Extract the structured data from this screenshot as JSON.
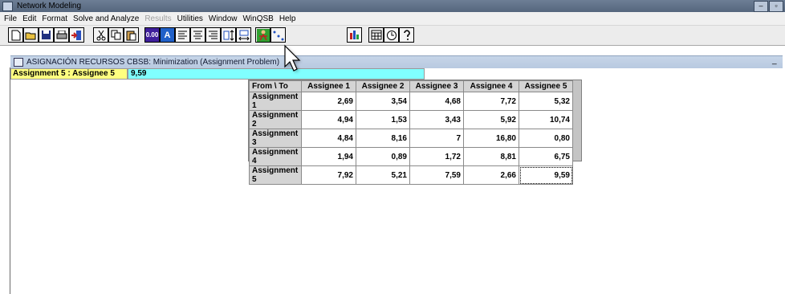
{
  "window": {
    "title": "Network Modeling",
    "controls": [
      "–",
      "▫"
    ]
  },
  "menu": [
    "File",
    "Edit",
    "Format",
    "Solve and Analyze",
    "Results",
    "Utilities",
    "Window",
    "WinQSB",
    "Help"
  ],
  "menu_disabled": [
    "Results"
  ],
  "toolbar": {
    "number_format_label": "0.00",
    "font_label": "A"
  },
  "child_window": {
    "title": "ASIGNACIÓN RECURSOS CBSB: Minimization (Assignment Problem)",
    "minimize": "_"
  },
  "edit_bar": {
    "cell_ref": "Assignment 5 : Assignee 5",
    "cell_value": "9,59"
  },
  "table": {
    "corner": "From \\ To",
    "columns": [
      "Assignee 1",
      "Assignee 2",
      "Assignee 3",
      "Assignee 4",
      "Assignee 5"
    ],
    "rows": [
      {
        "label": "Assignment 1",
        "values": [
          "2,69",
          "3,54",
          "4,68",
          "7,72",
          "5,32"
        ]
      },
      {
        "label": "Assignment 2",
        "values": [
          "4,94",
          "1,53",
          "3,43",
          "5,92",
          "10,74"
        ]
      },
      {
        "label": "Assignment 3",
        "values": [
          "4,84",
          "8,16",
          "7",
          "16,80",
          "0,80"
        ]
      },
      {
        "label": "Assignment 4",
        "values": [
          "1,94",
          "0,89",
          "1,72",
          "8,81",
          "6,75"
        ]
      },
      {
        "label": "Assignment 5",
        "values": [
          "7,92",
          "5,21",
          "7,59",
          "2,66",
          "9,59"
        ]
      }
    ]
  }
}
